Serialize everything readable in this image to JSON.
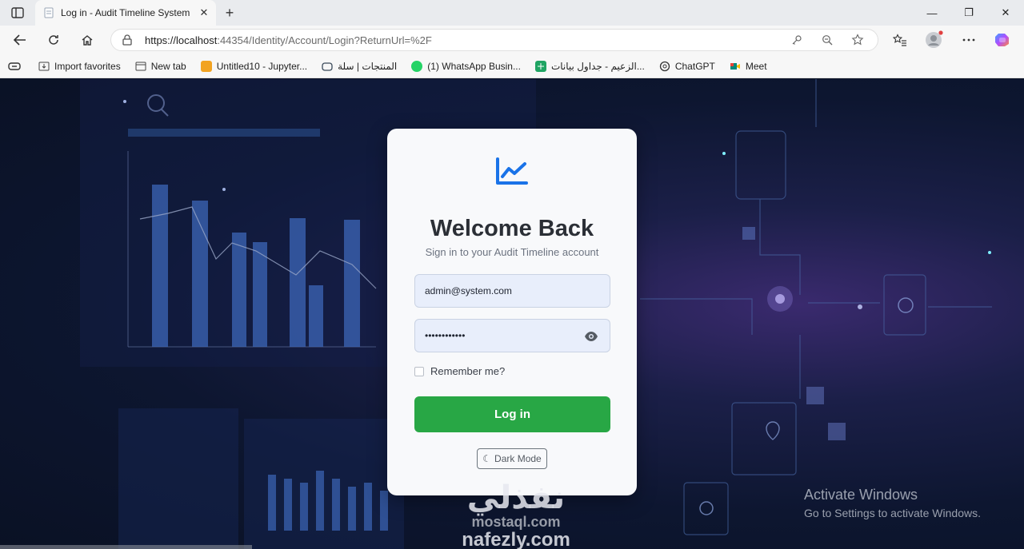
{
  "browser": {
    "tab_title": "Log in - Audit Timeline System",
    "tab_close": "✕",
    "new_tab": "+",
    "url_host": "https://localhost",
    "url_rest": ":44354/Identity/Account/Login?ReturnUrl=%2F",
    "window_controls": {
      "minimize": "—",
      "maximize": "❐",
      "close": "✕"
    }
  },
  "bookmarks": [
    {
      "label": "Import favorites",
      "icon": "import-icon",
      "color": "#444444"
    },
    {
      "label": "New tab",
      "icon": "newtab-icon",
      "color": "#444444"
    },
    {
      "label": "Untitled10 - Jupyter...",
      "icon": "jupyter-icon",
      "color": "#f2a321"
    },
    {
      "label": "المنتجات | سلة",
      "icon": "salla-icon",
      "color": "#3a4a5a"
    },
    {
      "label": "(1) WhatsApp Busin...",
      "icon": "whatsapp-icon",
      "color": "#25d366"
    },
    {
      "label": "الزعيم - جداول بيانات...",
      "icon": "sheets-icon",
      "color": "#1fa463"
    },
    {
      "label": "ChatGPT",
      "icon": "chatgpt-icon",
      "color": "#333333"
    },
    {
      "label": "Meet",
      "icon": "meet-icon",
      "color": "#00897b"
    }
  ],
  "login": {
    "title": "Welcome Back",
    "subtitle": "Sign in to your Audit Timeline account",
    "email_value": "admin@system.com",
    "password_value": "••••••••••••",
    "remember_label": "Remember me?",
    "login_button": "Log in",
    "dark_mode_button": "Dark Mode",
    "logo_icon": "chart-line-icon",
    "accent_color": "#28a745"
  },
  "os_overlay": {
    "activate_title": "Activate Windows",
    "activate_subtitle": "Go to Settings to activate Windows."
  },
  "watermark": {
    "arabic": "نفذلي",
    "site1": "mostaql.com",
    "site2": "nafezly.com"
  }
}
